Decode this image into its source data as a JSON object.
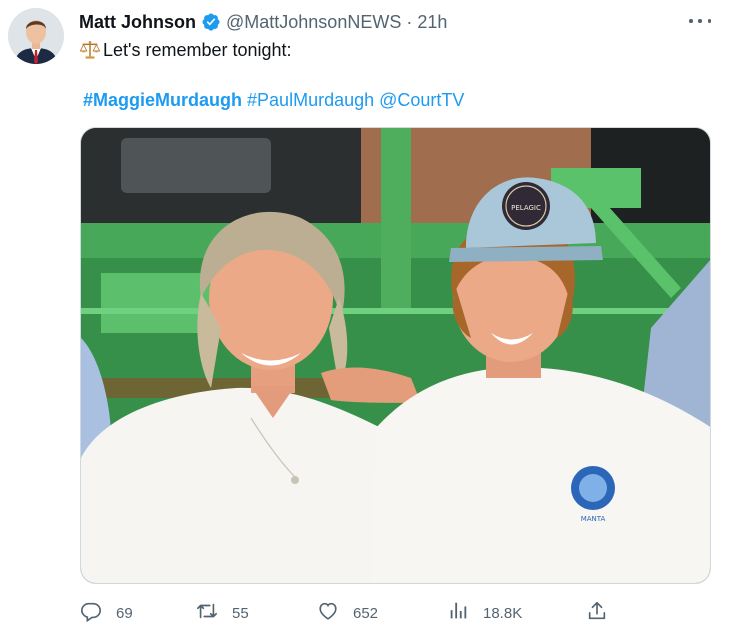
{
  "tweet": {
    "author_name": "Matt Johnson",
    "handle": "@MattJohnsonNEWS",
    "separator": "·",
    "time": "21h",
    "text": "Let's remember tonight:",
    "hashtags": [
      "#MaggieMurdaugh",
      "#PaulMurdaugh",
      "@CourtTV"
    ]
  },
  "media": {
    "cap_badge_text": "PELAGIC",
    "shirt_logo_text": "MANTA"
  },
  "actions": {
    "replies": "69",
    "retweets": "55",
    "likes": "652",
    "views": "18.8K"
  },
  "colors": {
    "link": "#1d9bf0",
    "secondary_text": "#536471",
    "verified": "#1d9bf0"
  },
  "icons": [
    "verified-badge-icon",
    "balance-scale-icon",
    "more-icon",
    "reply-icon",
    "retweet-icon",
    "like-icon",
    "views-icon",
    "share-icon"
  ]
}
